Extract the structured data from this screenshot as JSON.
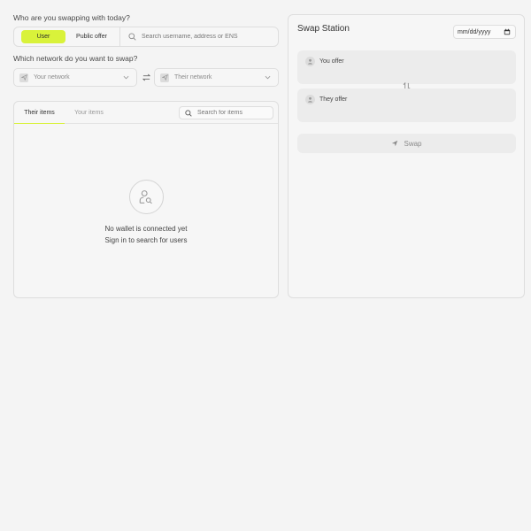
{
  "question_counterparty": "Who are you swapping with today?",
  "mode": {
    "options": [
      "User",
      "Public offer"
    ],
    "selected": "User",
    "search_placeholder": "Search username, address or ENS"
  },
  "question_network": "Which network do you want to swap?",
  "network": {
    "yours_placeholder": "Your network",
    "theirs_placeholder": "Their network"
  },
  "items_panel": {
    "tabs": [
      "Their items",
      "Your items"
    ],
    "active_tab": "Their items",
    "search_placeholder": "Search for items",
    "empty_line1": "No wallet is connected yet",
    "empty_line2": "Sign in to search for users"
  },
  "station": {
    "title": "Swap Station",
    "date_placeholder": "mm/dd/yyyy",
    "you_offer": "You offer",
    "they_offer": "They offer",
    "swap_label": "Swap"
  },
  "colors": {
    "accent": "#d9f23a",
    "background": "#f4f4f4",
    "panel": "#f6f6f6",
    "card": "#ececec",
    "border": "#dedede"
  },
  "icons": [
    "search-icon",
    "paper-plane-icon",
    "chevron-down-icon",
    "swap-arrows-icon",
    "user-search-icon",
    "user-icon",
    "calendar-icon",
    "exchange-arrows-icon"
  ]
}
